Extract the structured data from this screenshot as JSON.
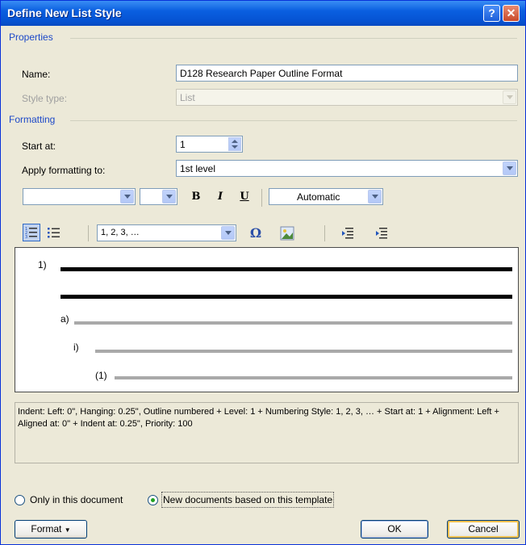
{
  "window": {
    "title": "Define New List Style"
  },
  "properties": {
    "section_label": "Properties",
    "name_label": "Name:",
    "name_value": "D128 Research Paper Outline Format",
    "style_type_label": "Style type:",
    "style_type_value": "List"
  },
  "formatting": {
    "section_label": "Formatting",
    "start_at_label": "Start at:",
    "start_at_value": "1",
    "apply_label": "Apply formatting to:",
    "apply_value": "1st level",
    "font_name_value": "",
    "font_size_value": "",
    "bold_label": "B",
    "italic_label": "I",
    "underline_label": "U",
    "color_value": "Automatic",
    "numbering_style_value": "1, 2, 3, …",
    "symbol_label": "Ω"
  },
  "preview": {
    "level1_label": "1)",
    "level2_label": "a)",
    "level3_label": "i)",
    "level4_label": "(1)"
  },
  "description": "Indent: Left:  0\", Hanging:  0.25\", Outline numbered + Level: 1 + Numbering Style: 1, 2, 3, … + Start at: 1 + Alignment: Left + Aligned at:  0\" + Indent at:  0.25\", Priority: 100",
  "scope": {
    "only_document_label": "Only in this document",
    "new_documents_label": "New documents based on this template",
    "selected": "new_documents"
  },
  "buttons": {
    "format": "Format",
    "ok": "OK",
    "cancel": "Cancel"
  },
  "colors": {
    "title_bar": "#0a5fe0",
    "section_text": "#1c48c8",
    "dialog_bg": "#ece9d8"
  }
}
